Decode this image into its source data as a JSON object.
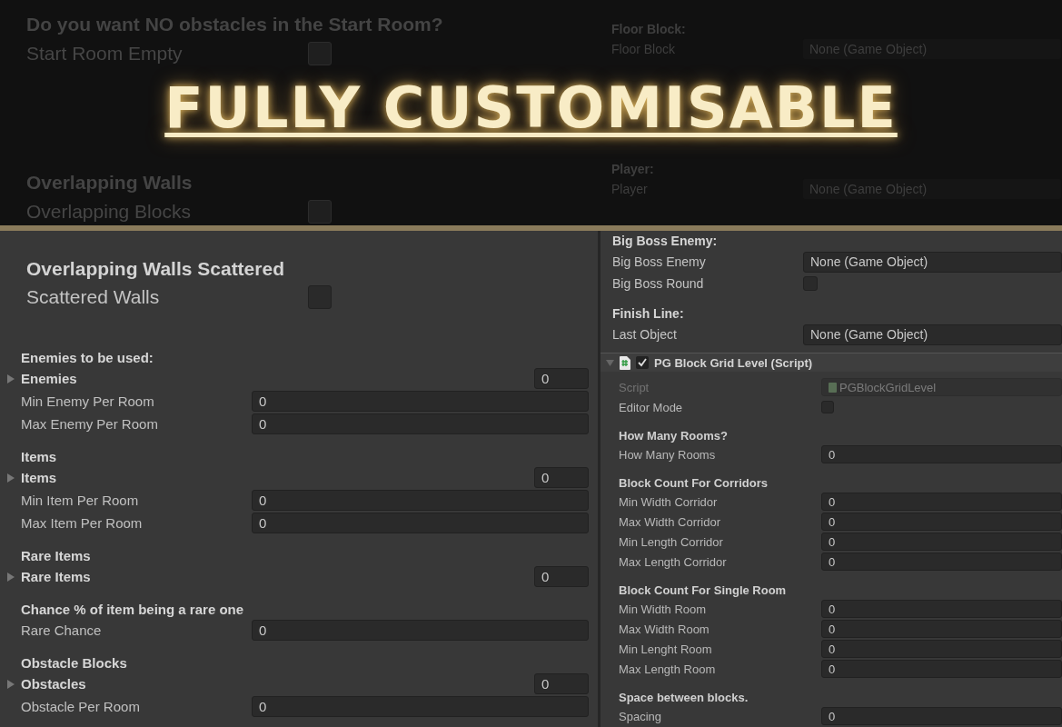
{
  "headline": "FULLY CUSTOMISABLE",
  "top_left": [
    [
      {
        "kind": "heading",
        "text": "Do you want NO obstacles in the Start Room?"
      },
      {
        "kind": "toggle",
        "label": "Start Room Empty",
        "checked": false
      }
    ],
    [
      {
        "kind": "heading",
        "text": "Overlapping Walls"
      },
      {
        "kind": "toggle",
        "label": "Overlapping Blocks",
        "checked": false
      }
    ]
  ],
  "top_right": [
    [
      {
        "kind": "heading",
        "text": "Floor Block:"
      },
      {
        "kind": "object",
        "label": "Floor Block",
        "value": "None (Game Object)"
      }
    ],
    [
      {
        "kind": "heading",
        "text": "Player:"
      },
      {
        "kind": "object",
        "label": "Player",
        "value": "None (Game Object)"
      }
    ]
  ],
  "scatter": [
    [
      {
        "kind": "heading",
        "text": "Overlapping Walls Scattered"
      },
      {
        "kind": "toggle",
        "label": "Scattered Walls",
        "checked": false
      }
    ]
  ],
  "spawn_settings": [
    [
      {
        "kind": "heading",
        "text": "Enemies to be used:"
      },
      {
        "kind": "list",
        "label": "Enemies",
        "value": "0",
        "expanded": false
      },
      {
        "kind": "field",
        "label": "Min Enemy Per Room",
        "value": "0"
      },
      {
        "kind": "field",
        "label": "Max Enemy Per Room",
        "value": "0"
      }
    ],
    [
      {
        "kind": "heading",
        "text": "Items"
      },
      {
        "kind": "list",
        "label": "Items",
        "value": "0",
        "expanded": false
      },
      {
        "kind": "field",
        "label": "Min Item Per Room",
        "value": "0"
      },
      {
        "kind": "field",
        "label": "Max Item Per Room",
        "value": "0"
      }
    ],
    [
      {
        "kind": "heading",
        "text": "Rare Items"
      },
      {
        "kind": "list",
        "label": "Rare Items",
        "value": "0",
        "expanded": false
      }
    ],
    [
      {
        "kind": "heading",
        "text": "Chance % of item being a rare one"
      },
      {
        "kind": "field",
        "label": "Rare Chance",
        "value": "0"
      }
    ],
    [
      {
        "kind": "heading",
        "text": "Obstacle Blocks"
      },
      {
        "kind": "list",
        "label": "Obstacles",
        "value": "0",
        "expanded": false
      },
      {
        "kind": "field",
        "label": "Obstacle Per Room",
        "value": "0"
      }
    ]
  ],
  "boss_settings": [
    [
      {
        "kind": "heading",
        "text": "Big Boss Enemy:"
      },
      {
        "kind": "object",
        "label": "Big Boss Enemy",
        "value": "None (Game Object)"
      },
      {
        "kind": "toggle",
        "label": "Big Boss Round",
        "checked": false
      }
    ],
    [
      {
        "kind": "heading",
        "text": "Finish Line:"
      },
      {
        "kind": "object",
        "label": "Last Object",
        "value": "None (Game Object)"
      }
    ]
  ],
  "component": {
    "title": "PG Block Grid Level (Script)",
    "expanded": true,
    "enabled": true,
    "groups": [
      [
        {
          "kind": "script",
          "label": "Script",
          "value": "PGBlockGridLevel",
          "disabled": true
        },
        {
          "kind": "toggle",
          "label": "Editor Mode",
          "checked": false
        }
      ],
      [
        {
          "kind": "heading",
          "text": "How Many Rooms?"
        },
        {
          "kind": "field",
          "label": "How Many Rooms",
          "value": "0"
        }
      ],
      [
        {
          "kind": "heading",
          "text": "Block Count For Corridors"
        },
        {
          "kind": "field",
          "label": "Min Width Corridor",
          "value": "0"
        },
        {
          "kind": "field",
          "label": "Max Width Corridor",
          "value": "0"
        },
        {
          "kind": "field",
          "label": "Min Length Corridor",
          "value": "0"
        },
        {
          "kind": "field",
          "label": "Max Length Corridor",
          "value": "0"
        }
      ],
      [
        {
          "kind": "heading",
          "text": "Block Count For Single Room"
        },
        {
          "kind": "field",
          "label": "Min Width Room",
          "value": "0"
        },
        {
          "kind": "field",
          "label": "Max Width Room",
          "value": "0"
        },
        {
          "kind": "field",
          "label": "Min Lenght Room",
          "value": "0"
        },
        {
          "kind": "field",
          "label": "Max Length Room",
          "value": "0"
        }
      ],
      [
        {
          "kind": "heading",
          "text": "Space between blocks."
        },
        {
          "kind": "field",
          "label": "Spacing",
          "value": "0"
        }
      ]
    ]
  }
}
